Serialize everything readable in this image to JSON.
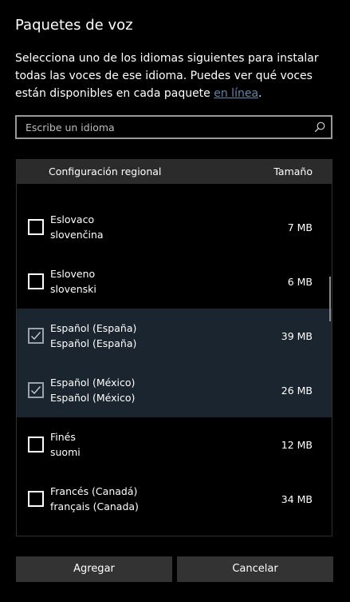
{
  "dialog": {
    "title": "Paquetes de voz",
    "description": "Selecciona uno de los idiomas siguientes para instalar todas las voces de ese idioma. Puedes ver qué voces están disponibles en cada paquete ",
    "description_link": "en línea",
    "description_end": "."
  },
  "search": {
    "placeholder": "Escribe un idioma",
    "icon": "search-icon"
  },
  "list": {
    "header_region": "Configuración regional",
    "header_size": "Tamaño",
    "items": [
      {
        "name": "Eslovaco",
        "native": "slovenčina",
        "size": "7 MB",
        "checked": false
      },
      {
        "name": "Esloveno",
        "native": "slovenski",
        "size": "6 MB",
        "checked": false
      },
      {
        "name": "Español (España)",
        "native": "Español (España)",
        "size": "39 MB",
        "checked": true
      },
      {
        "name": "Español (México)",
        "native": "Español (México)",
        "size": "26 MB",
        "checked": true
      },
      {
        "name": "Finés",
        "native": "suomi",
        "size": "12 MB",
        "checked": false
      },
      {
        "name": "Francés (Canadá)",
        "native": "français (Canada)",
        "size": "34 MB",
        "checked": false
      }
    ]
  },
  "buttons": {
    "add": "Agregar",
    "cancel": "Cancelar"
  },
  "colors": {
    "background": "#000000",
    "selected_row": "#1b252f",
    "link": "#5f87a8",
    "button": "#333333",
    "header": "#2b2b2b"
  }
}
